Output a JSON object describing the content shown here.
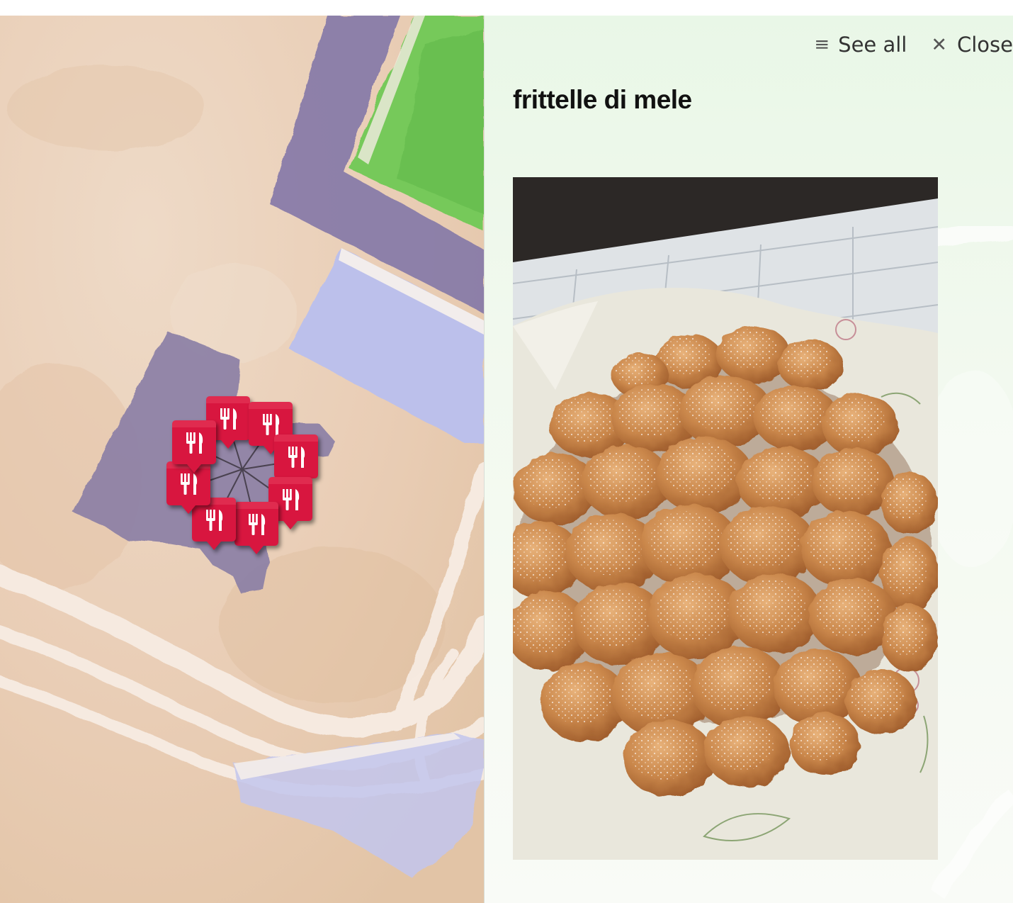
{
  "map": {
    "marker_icon": "fork-knife-icon",
    "marker_color": "#d8163f",
    "paper_color": "#ead2bd",
    "building_color": "#8a79a6",
    "pool_color": "#b7bde8",
    "lawn_color": "#72cc58"
  },
  "panel": {
    "see_all_icon": "list-icon",
    "see_all_label": "See all",
    "close_icon": "close-icon",
    "close_label": "Close",
    "title": "frittelle di mele",
    "photo_subject": "apple-fritters-photo"
  }
}
